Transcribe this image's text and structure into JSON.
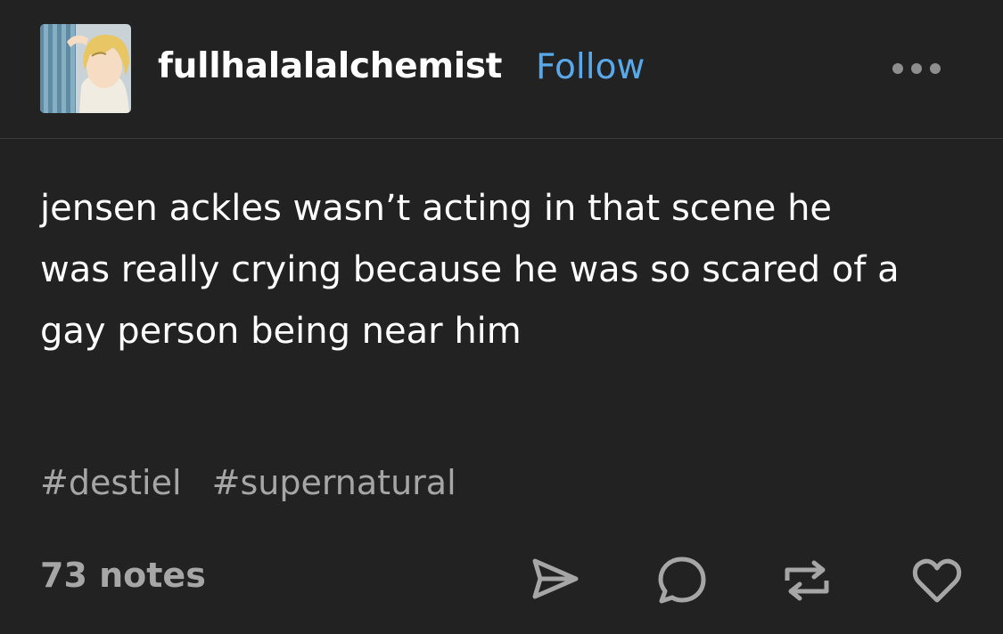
{
  "post": {
    "username": "fullhalalalchemist",
    "follow_label": "Follow",
    "body_lines": [
      "jensen ackles wasn’t acting in that scene he",
      "was really crying because he was so scared of a",
      "gay person being near him"
    ],
    "tags": [
      "#destiel",
      "#supernatural"
    ],
    "notes": "73 notes"
  },
  "actions": {
    "more": "more-options-icon",
    "share": "share-icon",
    "reply": "reply-icon",
    "reblog": "reblog-icon",
    "like": "heart-icon"
  },
  "colors": {
    "background": "#222222",
    "accent": "#59a9ea",
    "muted": "#a6a6a6",
    "text": "#ffffff"
  }
}
